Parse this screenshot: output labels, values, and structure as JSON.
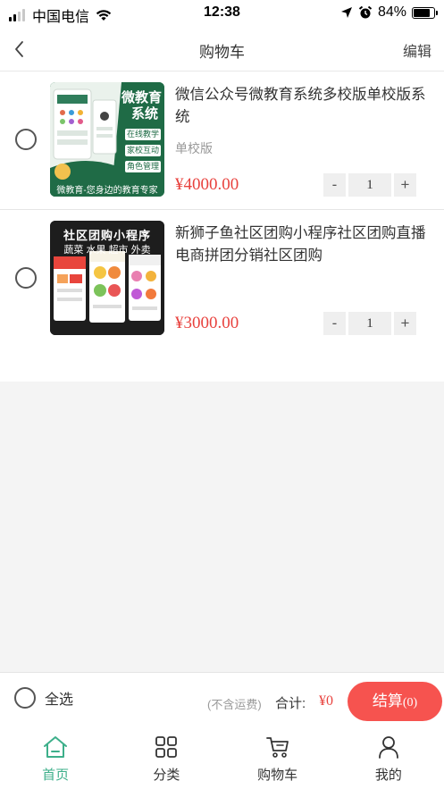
{
  "status_bar": {
    "carrier": "中国电信",
    "time": "12:38",
    "battery": "84%",
    "battery_level": 0.84
  },
  "nav": {
    "title": "购物车",
    "edit_label": "编辑"
  },
  "cart": {
    "items": [
      {
        "title": "微信公众号微教育系统多校版单校版系统",
        "spec": "单校版",
        "price": "¥4000.00",
        "qty": "1",
        "thumb": {
          "headline1": "微教育",
          "headline2": "系统",
          "tags": [
            "在线教学",
            "家校互动",
            "角色管理"
          ],
          "footer": "微教育-您身边的教育专家"
        }
      },
      {
        "title": "新狮子鱼社区团购小程序社区团购直播电商拼团分销社区团购",
        "spec": "",
        "price": "¥3000.00",
        "qty": "1",
        "thumb": {
          "headline": "社区团购小程序",
          "subline": "蔬菜 水果 超市 外卖"
        }
      }
    ],
    "minus_label": "-",
    "plus_label": "+"
  },
  "checkout": {
    "select_all_label": "全选",
    "shipping_note": "(不含运费)",
    "total_label": "合计:",
    "total_value": "¥0",
    "checkout_label": "结算",
    "checkout_count": "(0)"
  },
  "tabs": [
    {
      "label": "首页",
      "icon": "home-icon",
      "active": true
    },
    {
      "label": "分类",
      "icon": "grid-icon",
      "active": false
    },
    {
      "label": "购物车",
      "icon": "cart-icon",
      "active": false
    },
    {
      "label": "我的",
      "icon": "user-icon",
      "active": false
    }
  ],
  "colors": {
    "accent": "#3daf8a",
    "price": "#e8423e",
    "checkout_button": "#f6534f"
  }
}
